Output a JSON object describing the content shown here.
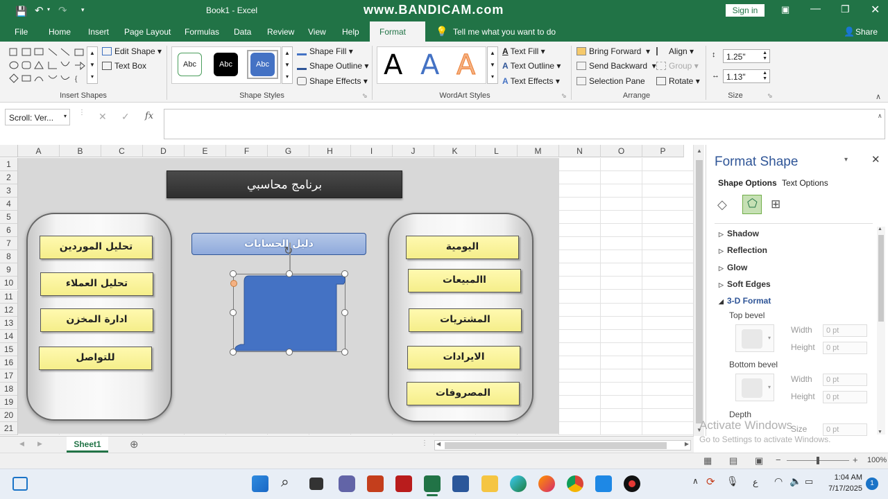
{
  "window": {
    "title": "Book1  -  Excel",
    "watermark": "www.BANDICAM.com",
    "sign_in": "Sign in"
  },
  "tabs": [
    "File",
    "Home",
    "Insert",
    "Page Layout",
    "Formulas",
    "Data",
    "Review",
    "View",
    "Help",
    "Format"
  ],
  "active_tab": "Format",
  "tell_me": "Tell me what you want to do",
  "share": "Share",
  "ribbon": {
    "insert_shapes": {
      "label": "Insert Shapes",
      "edit_shape": "Edit Shape",
      "text_box": "Text Box"
    },
    "shape_styles": {
      "label": "Shape Styles",
      "swatches": [
        "Abc",
        "Abc",
        "Abc"
      ],
      "shape_fill": "Shape Fill",
      "shape_outline": "Shape Outline",
      "shape_effects": "Shape Effects"
    },
    "wordart": {
      "label": "WordArt Styles",
      "letters": [
        "A",
        "A",
        "A"
      ],
      "text_fill": "Text Fill",
      "text_outline": "Text Outline",
      "text_effects": "Text Effects"
    },
    "arrange": {
      "label": "Arrange",
      "bring_forward": "Bring Forward",
      "send_backward": "Send Backward",
      "selection_pane": "Selection Pane",
      "align": "Align",
      "group": "Group",
      "rotate": "Rotate"
    },
    "size": {
      "label": "Size",
      "height": "1.25\"",
      "width": "1.13\""
    }
  },
  "namebox": "Scroll: Ver...",
  "fx": "fx",
  "columns": [
    "A",
    "B",
    "C",
    "D",
    "E",
    "F",
    "G",
    "H",
    "I",
    "J",
    "K",
    "L",
    "M",
    "N",
    "O",
    "P"
  ],
  "rows": [
    "1",
    "2",
    "3",
    "4",
    "5",
    "6",
    "7",
    "8",
    "9",
    "10",
    "11",
    "12",
    "13",
    "14",
    "15",
    "16",
    "17",
    "18",
    "19",
    "20",
    "21"
  ],
  "shapes": {
    "title": "برنامج محاسبي",
    "left_buttons": [
      "تحليل الموردين",
      "تحليل العملاء",
      "ادارة المخزن",
      "للتواصل"
    ],
    "center_header": "دليل الحسابات",
    "right_buttons": [
      "اليومية",
      "االمبيعات",
      "المشتريات",
      "الايرادات",
      "المصروفات"
    ]
  },
  "sheet_tab": "Sheet1",
  "zoom": "100%",
  "format_pane": {
    "title": "Format Shape",
    "tab_shape_options": "Shape Options",
    "tab_text_options": "Text Options",
    "sections": [
      "Shadow",
      "Reflection",
      "Glow",
      "Soft Edges",
      "3-D Format"
    ],
    "top_bevel": "Top bevel",
    "bottom_bevel": "Bottom bevel",
    "depth": "Depth",
    "width_label": "Width",
    "height_label": "Height",
    "size_label": "Size",
    "zero_pt": "0 pt"
  },
  "activate": {
    "line1": "Activate Windows",
    "line2": "Go to Settings to activate Windows."
  },
  "taskbar": {
    "lang": "ع",
    "time": "1:04 AM",
    "date": "7/17/2025",
    "notif": "1"
  }
}
